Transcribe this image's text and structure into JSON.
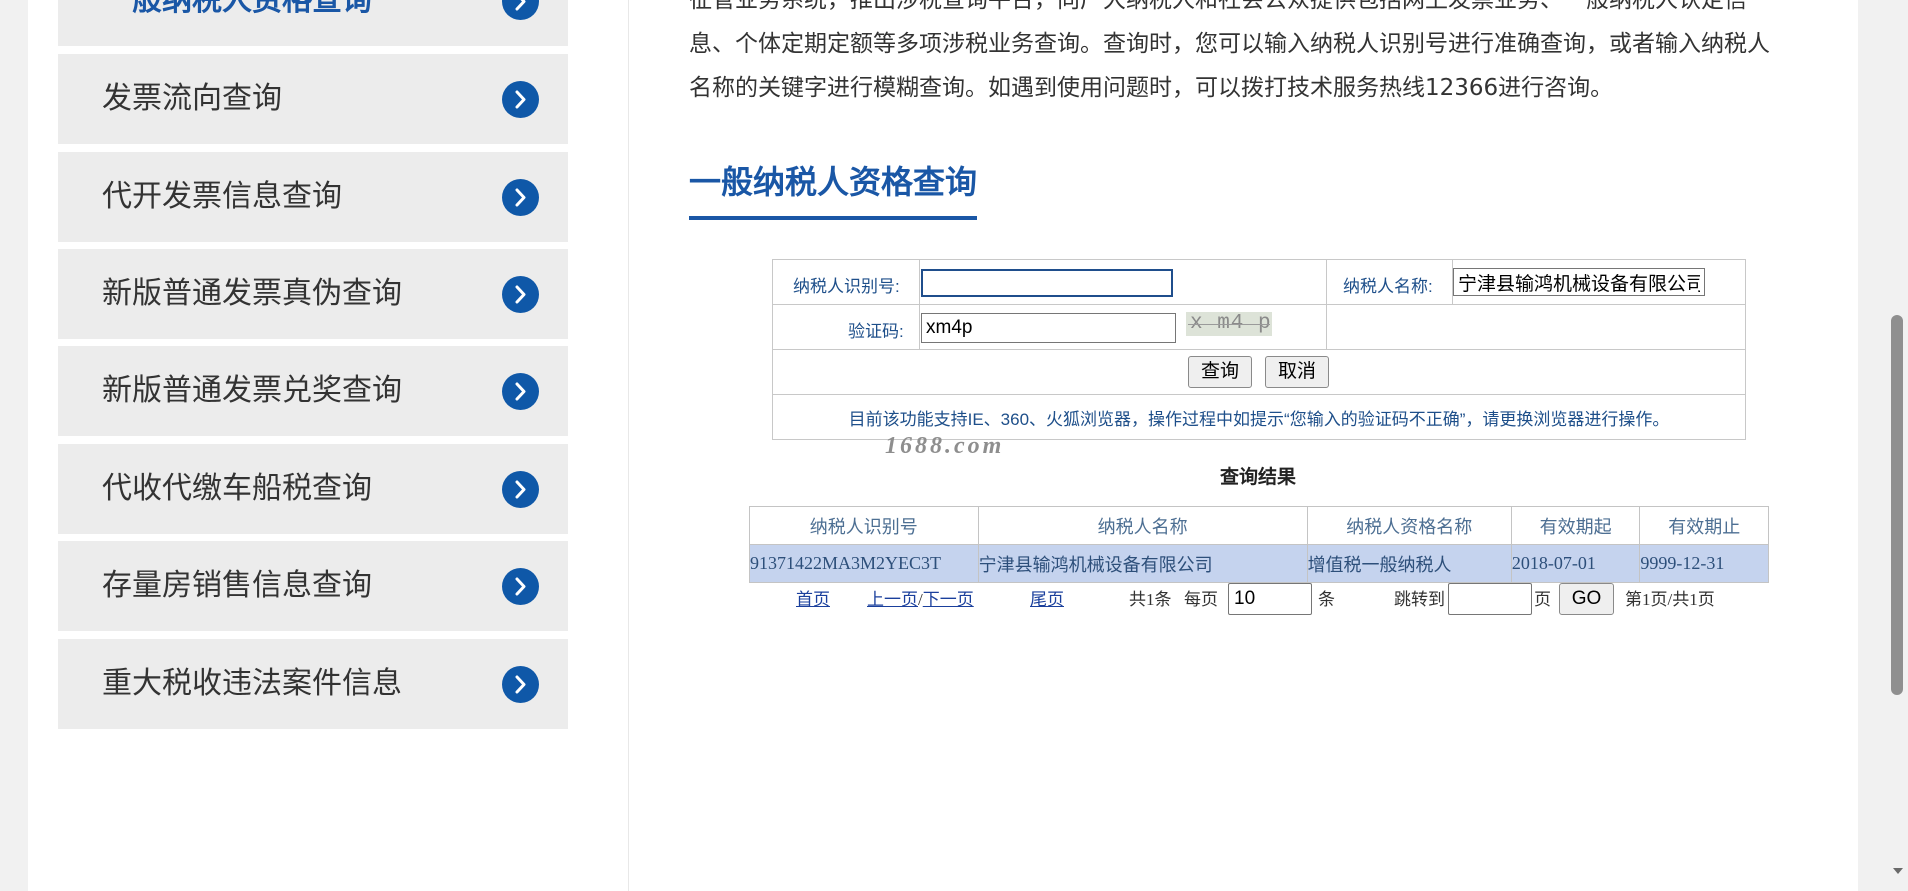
{
  "sidebar": {
    "items": [
      {
        "label": "一般纳税人资格查询",
        "active": true
      },
      {
        "label": "发票流向查询"
      },
      {
        "label": "代开发票信息查询"
      },
      {
        "label": "新版普通发票真伪查询"
      },
      {
        "label": "新版普通发票兑奖查询"
      },
      {
        "label": "代收代缴车船税查询"
      },
      {
        "label": "存量房销售信息查询"
      },
      {
        "label": "重大税收违法案件信息"
      }
    ]
  },
  "intro": {
    "line1": "征管业务系统，推出涉税查询平台，向广大纳税人和社会公众提供包括网上发票业务、一般纳税人认定信",
    "line2": "息、个体定期定额等多项涉税业务查询。查询时，您可以输入纳税人识别号进行准确查询，或者输入纳税人",
    "line3": "名称的关键字进行模糊查询。如遇到使用问题时，可以拨打技术服务热线12366进行咨询。"
  },
  "section": {
    "title": "一般纳税人资格查询"
  },
  "form": {
    "taxpayer_id_label": "纳税人识别号:",
    "taxpayer_id_value": "",
    "taxpayer_name_label": "纳税人名称:",
    "taxpayer_name_value": "宁津县输鸿机械设备有限公司",
    "captcha_label": "验证码:",
    "captcha_value": "xm4p",
    "captcha_image_text": "x m4 p",
    "query_button": "查询",
    "cancel_button": "取消",
    "notice": "目前该功能支持IE、360、火狐浏览器，操作过程中如提示“您输入的验证码不正确”，请更换浏览器进行操作。"
  },
  "watermark": "1688.com",
  "results": {
    "title": "查询结果",
    "columns": [
      "纳税人识别号",
      "纳税人名称",
      "纳税人资格名称",
      "有效期起",
      "有效期止"
    ],
    "rows": [
      [
        "91371422MA3M2YEC3T",
        "宁津县输鸿机械设备有限公司",
        "增值税一般纳税人",
        "2018-07-01",
        "9999-12-31"
      ]
    ]
  },
  "pager": {
    "first": "首页",
    "prev": "上一页",
    "slash": "/",
    "next": "下一页",
    "last": "尾页",
    "total": "共1条",
    "per_page_label": "每页",
    "per_page_value": "10",
    "per_page_unit": "条",
    "jump_label": "跳转到",
    "jump_value": "",
    "page_unit": "页",
    "go_button": "GO",
    "page_info": "第1页/共1页"
  },
  "colors": {
    "accent": "#1a57a6",
    "arrow_bg": "#0f58a8",
    "result_row_bg": "#c5d3ee"
  }
}
